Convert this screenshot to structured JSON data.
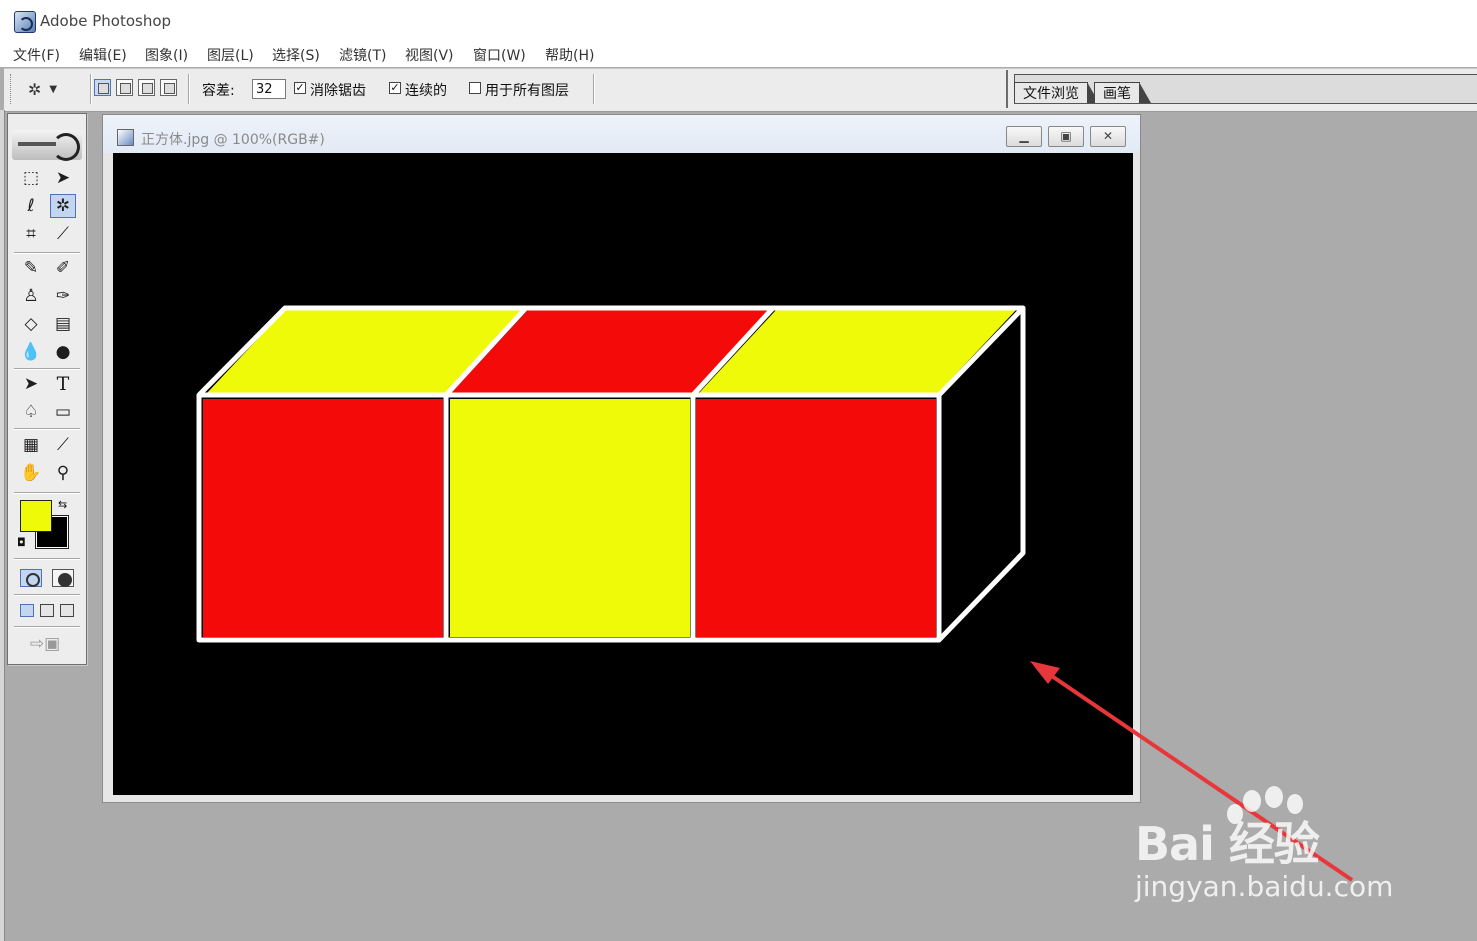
{
  "app": {
    "title": "Adobe Photoshop",
    "icon": "photoshop-app-icon"
  },
  "menu": {
    "items": [
      {
        "label": "文件(F)"
      },
      {
        "label": "编辑(E)"
      },
      {
        "label": "图象(I)"
      },
      {
        "label": "图层(L)"
      },
      {
        "label": "选择(S)"
      },
      {
        "label": "滤镜(T)"
      },
      {
        "label": "视图(V)"
      },
      {
        "label": "窗口(W)"
      },
      {
        "label": "帮助(H)"
      }
    ]
  },
  "options": {
    "tool_icon": "magic-wand-icon",
    "tolerance_label": "容差:",
    "tolerance_value": "32",
    "anti_alias_label": "消除锯齿",
    "anti_alias_checked": true,
    "contiguous_label": "连续的",
    "contiguous_checked": true,
    "all_layers_label": "用于所有图层",
    "all_layers_checked": false
  },
  "palette_well": {
    "tabs": [
      {
        "label": "文件浏览"
      },
      {
        "label": "画笔"
      }
    ]
  },
  "toolbox": {
    "tools": [
      "marquee-icon",
      "move-icon",
      "lasso-icon",
      "magic-wand-icon",
      "crop-icon",
      "slice-icon",
      "healing-brush-icon",
      "brush-icon",
      "clone-stamp-icon",
      "history-brush-icon",
      "eraser-icon",
      "gradient-icon",
      "blur-icon",
      "dodge-icon",
      "path-selection-icon",
      "type-icon",
      "pen-icon",
      "shape-icon",
      "notes-icon",
      "eyedropper-icon",
      "hand-icon",
      "zoom-icon"
    ],
    "active_tool": "magic-wand-icon",
    "type_tool_glyph": "T",
    "foreground_color": "#eefa07",
    "background_color": "#000000"
  },
  "document": {
    "title": "正方体.jpg @ 100%(RGB#)",
    "canvas_background": "#000000",
    "colors": {
      "yellow": "#eefa07",
      "red": "#f50a0a",
      "outline": "#ffffff"
    },
    "window_buttons": [
      "minimize-icon",
      "restore-icon",
      "close-icon"
    ]
  },
  "annotation": {
    "arrow_color": "#e8373a"
  },
  "watermark": {
    "brand": "Bai 经验",
    "url": "jingyan.baidu.com"
  }
}
